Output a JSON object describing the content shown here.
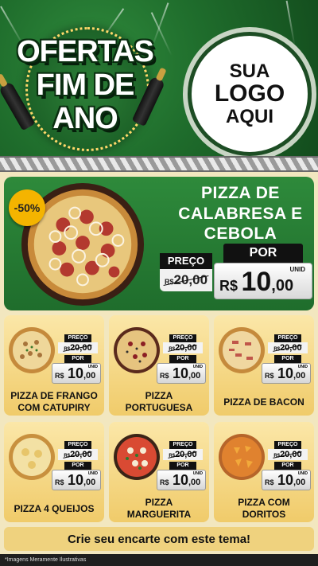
{
  "header": {
    "promo_line1": "OFERTAS",
    "promo_line2": "FIM DE",
    "promo_line3": "ANO",
    "logo_line1": "SUA",
    "logo_line2": "LOGO",
    "logo_line3": "AQUI"
  },
  "featured": {
    "discount": "-50%",
    "name_line1": "PIZZA DE",
    "name_line2": "CALABRESA E",
    "name_line3": "CEBOLA",
    "preco_label": "PREÇO",
    "por_label": "POR",
    "old_currency": "R$",
    "old_price": "20,00",
    "unid_label": "UNID",
    "new_currency": "R$",
    "new_int": "10",
    "new_dec": ",00"
  },
  "products": [
    {
      "line1": "PIZZA DE FRANGO",
      "line2": "COM CATUPIRY",
      "preco_label": "PREÇO",
      "old_currency": "R$",
      "old_price": "20,00",
      "por_label": "POR",
      "unid_label": "UNID",
      "new_currency": "R$",
      "new_int": "10",
      "new_dec": ",00"
    },
    {
      "line1": "PIZZA",
      "line2": "PORTUGUESA",
      "preco_label": "PREÇO",
      "old_currency": "R$",
      "old_price": "20,00",
      "por_label": "POR",
      "unid_label": "UNID",
      "new_currency": "R$",
      "new_int": "10",
      "new_dec": ",00"
    },
    {
      "line1": "PIZZA DE BACON",
      "line2": "",
      "preco_label": "PREÇO",
      "old_currency": "R$",
      "old_price": "20,00",
      "por_label": "POR",
      "unid_label": "UNID",
      "new_currency": "R$",
      "new_int": "10",
      "new_dec": ",00"
    },
    {
      "line1": "PIZZA 4 QUEIJOS",
      "line2": "",
      "preco_label": "PREÇO",
      "old_currency": "R$",
      "old_price": "20,00",
      "por_label": "POR",
      "unid_label": "UNID",
      "new_currency": "R$",
      "new_int": "10",
      "new_dec": ",00"
    },
    {
      "line1": "PIZZA",
      "line2": "MARGUERITA",
      "preco_label": "PREÇO",
      "old_currency": "R$",
      "old_price": "20,00",
      "por_label": "POR",
      "unid_label": "UNID",
      "new_currency": "R$",
      "new_int": "10",
      "new_dec": ",00"
    },
    {
      "line1": "PIZZA COM",
      "line2": "DORITOS",
      "preco_label": "PREÇO",
      "old_currency": "R$",
      "old_price": "20,00",
      "por_label": "POR",
      "unid_label": "UNID",
      "new_currency": "R$",
      "new_int": "10",
      "new_dec": ",00"
    }
  ],
  "cta": "Crie seu encarte com este tema!",
  "footnote": "*Imagens Meramente Ilustrativas",
  "colors": {
    "green": "#1f6d2c",
    "gold": "#f0cb6a",
    "badge": "#f4b400"
  }
}
